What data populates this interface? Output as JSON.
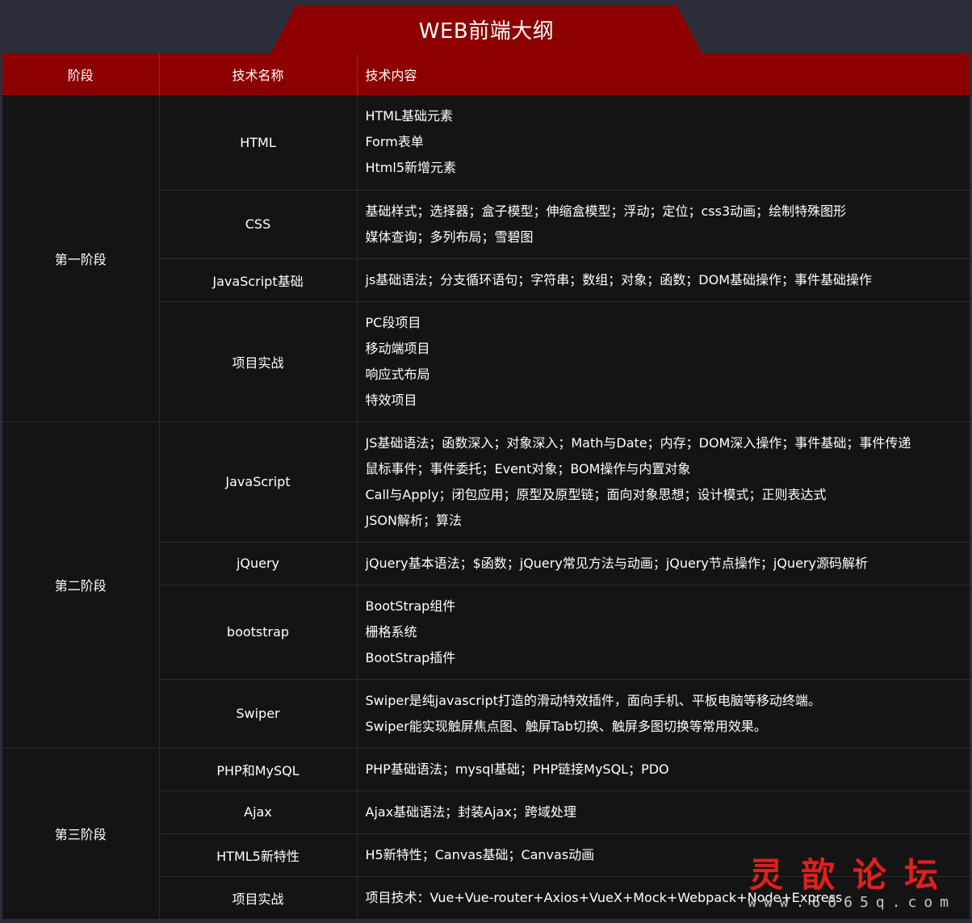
{
  "title": "WEB前端大纲",
  "headers": {
    "stage": "阶段",
    "tech_name": "技术名称",
    "tech_content": "技术内容"
  },
  "stages": [
    {
      "label": "第一阶段",
      "rows": [
        {
          "tech": "HTML",
          "lines": [
            "HTML基础元素",
            "Form表单",
            "Html5新增元素"
          ]
        },
        {
          "tech": "CSS",
          "lines": [
            "基础样式；选择器；盒子模型；伸缩盒模型；浮动；定位；css3动画；绘制特殊图形",
            "媒体查询；多列布局；雪碧图"
          ]
        },
        {
          "tech": "JavaScript基础",
          "lines": [
            "js基础语法；分支循环语句；字符串；数组；对象；函数；DOM基础操作；事件基础操作"
          ]
        },
        {
          "tech": "项目实战",
          "lines": [
            "PC段项目",
            "移动端项目",
            "响应式布局",
            "特效项目"
          ]
        }
      ]
    },
    {
      "label": "第二阶段",
      "rows": [
        {
          "tech": "JavaScript",
          "lines": [
            "JS基础语法；函数深入；对象深入；Math与Date；内存；DOM深入操作；事件基础；事件传递",
            "鼠标事件；事件委托；Event对象；BOM操作与内置对象",
            "Call与Apply；闭包应用；原型及原型链；面向对象思想；设计模式；正则表达式",
            "JSON解析；算法"
          ]
        },
        {
          "tech": "jQuery",
          "lines": [
            "jQuery基本语法；$函数；jQuery常见方法与动画；jQuery节点操作；jQuery源码解析"
          ]
        },
        {
          "tech": "bootstrap",
          "lines": [
            "BootStrap组件",
            "栅格系统",
            "BootStrap插件"
          ]
        },
        {
          "tech": "Swiper",
          "lines": [
            "Swiper是纯javascript打造的滑动特效插件，面向手机、平板电脑等移动终端。",
            "Swiper能实现触屏焦点图、触屏Tab切换、触屏多图切换等常用效果。"
          ]
        }
      ]
    },
    {
      "label": "第三阶段",
      "rows": [
        {
          "tech": "PHP和MySQL",
          "lines": [
            "PHP基础语法；mysql基础；PHP链接MySQL；PDO"
          ]
        },
        {
          "tech": "Ajax",
          "lines": [
            "Ajax基础语法；封装Ajax；跨域处理"
          ]
        },
        {
          "tech": "HTML5新特性",
          "lines": [
            "H5新特性；Canvas基础；Canvas动画"
          ]
        },
        {
          "tech": "项目实战",
          "lines": [
            "项目技术：Vue+Vue-router+Axios+VueX+Mock+Webpack+Node+Express"
          ]
        }
      ]
    }
  ],
  "watermark": {
    "name": "灵歆论坛",
    "url": "www.6665q.com"
  }
}
